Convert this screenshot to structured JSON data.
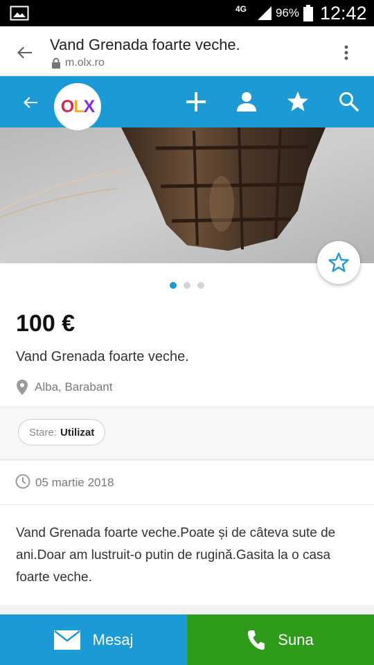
{
  "status_bar": {
    "network": "4G",
    "battery": "96%",
    "time": "12:42"
  },
  "browser": {
    "page_title": "Vand Grenada foarte veche.",
    "url": "m.olx.ro",
    "icons": [
      "back-arrow-icon",
      "lock-icon",
      "more-vert-icon"
    ]
  },
  "header": {
    "logo_text": [
      "O",
      "L",
      "X"
    ],
    "logo_colors": [
      "#d9254f",
      "#f2b01e",
      "#8a2be2"
    ],
    "accent_color": "#1b9ad6",
    "icons": [
      "back-arrow-icon",
      "add-icon",
      "account-icon",
      "star-icon",
      "search-icon"
    ]
  },
  "gallery": {
    "photo_count": 3,
    "active_index": 0,
    "favorite_icon": "star-outline-icon"
  },
  "ad": {
    "price": "100 €",
    "title": "Vand Grenada foarte veche.",
    "location": "Alba, Barabant",
    "params": [
      {
        "label": "Stare:",
        "value": "Utilizat"
      }
    ],
    "date": "05 martie 2018",
    "description": "Vand Grenada foarte veche.Poate și de câteva sute de ani.Doar am lustruit-o putin de rugină.Gasita la o casa foarte veche."
  },
  "actions": {
    "message_label": "Mesaj",
    "call_label": "Suna",
    "message_color": "#1b9ad6",
    "call_color": "#2e9c1a"
  }
}
